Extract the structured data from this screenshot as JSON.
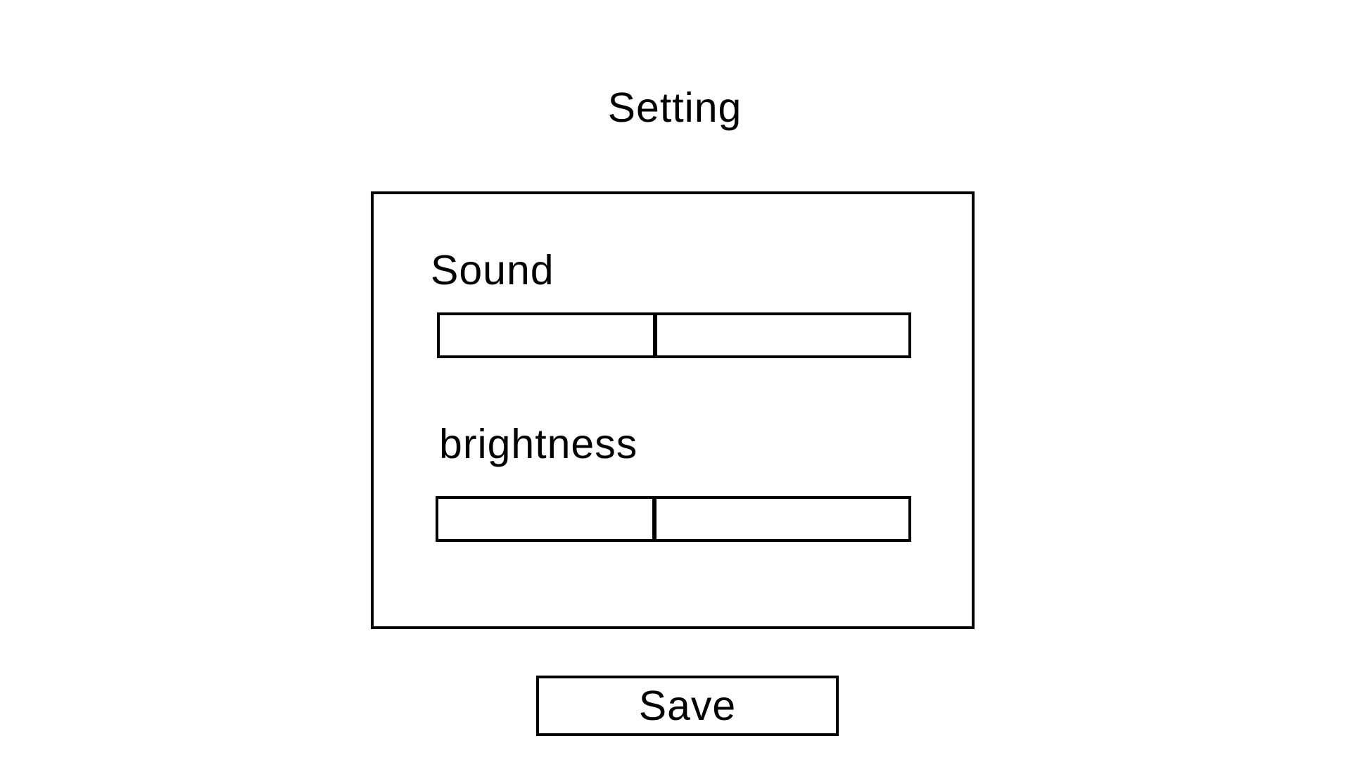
{
  "page": {
    "title": "Setting"
  },
  "settings": {
    "sound": {
      "label": "Sound",
      "value": 0.46
    },
    "brightness": {
      "label": "brightness",
      "value": 0.46
    }
  },
  "actions": {
    "save_label": "Save"
  },
  "colors": {
    "background": "#ffffff",
    "foreground": "#000000"
  }
}
